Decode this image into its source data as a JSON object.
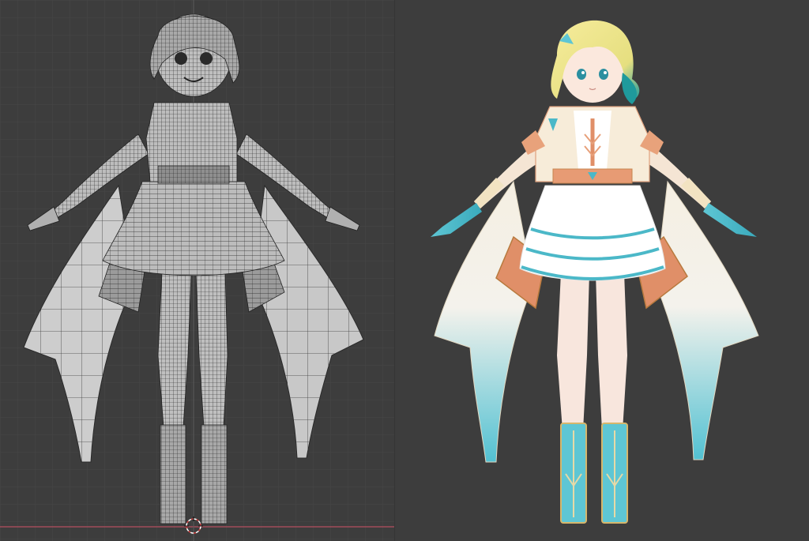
{
  "app": {
    "title": ""
  },
  "viewports": {
    "left": {
      "name": "viewport-wireframe",
      "shading": "wireframe"
    },
    "right": {
      "name": "viewport-material-preview",
      "shading": "material"
    }
  },
  "colors": {
    "background": "#3d3d3d",
    "grid": "#484848",
    "grid_major": "#515151",
    "axis_x": "#a14d5a",
    "axis_y": "#6f8f3f",
    "wire": "#1e1e1e",
    "mesh_fill": "#cfcfcf",
    "skin": "#f6e1d8",
    "hair": "#f2e58a",
    "hair_tip": "#2a9aa0",
    "coat": "#f7ecd9",
    "coat_accent": "#e79b74",
    "cape_top": "#f5efe2",
    "cape_bottom": "#58c3d3",
    "teal": "#5ec6d4",
    "gold": "#c9a458"
  },
  "icons": {
    "origin": "3d-cursor-icon"
  }
}
